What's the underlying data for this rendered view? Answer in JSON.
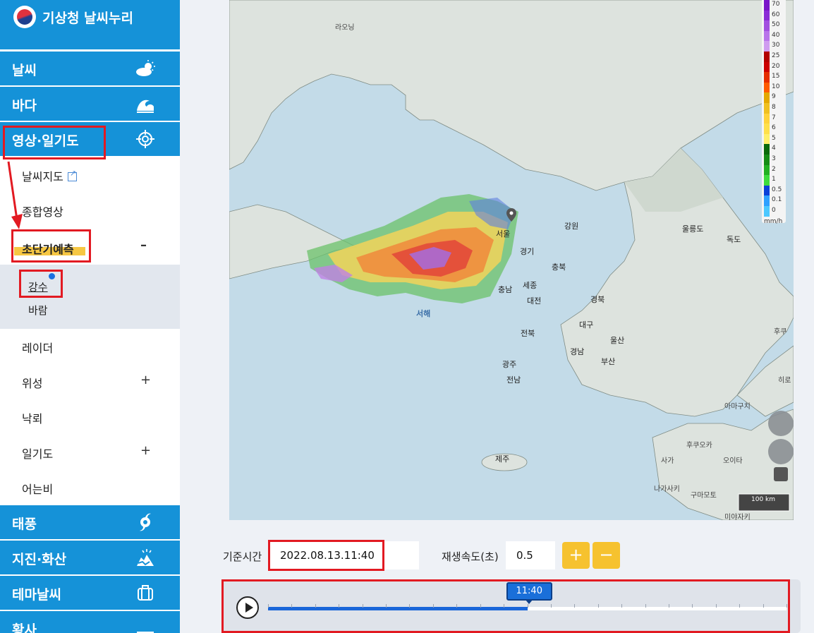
{
  "app": {
    "title": "기상청 날씨누리"
  },
  "sidebar": {
    "categories": [
      {
        "label": "날씨",
        "icon": "weather-icon"
      },
      {
        "label": "바다",
        "icon": "wave-icon"
      },
      {
        "label": "영상·일기도",
        "icon": "crosshair-icon"
      },
      {
        "label": "태풍",
        "icon": "typhoon-icon"
      },
      {
        "label": "지진·화산",
        "icon": "earthquake-icon"
      },
      {
        "label": "테마날씨",
        "icon": "suitcase-icon"
      },
      {
        "label": "황사",
        "icon": "dust-icon"
      }
    ],
    "submenu": [
      {
        "label": "날씨지도",
        "icon": "external-link-icon"
      },
      {
        "label": "종합영상"
      },
      {
        "label": "초단기예측",
        "toggle": "–"
      },
      {
        "label": "레이더"
      },
      {
        "label": "위성",
        "toggle": "+"
      },
      {
        "label": "낙뢰"
      },
      {
        "label": "일기도",
        "toggle": "+"
      },
      {
        "label": "어는비"
      }
    ],
    "subsub": [
      {
        "label": "강수",
        "selected": true
      },
      {
        "label": "바람"
      }
    ]
  },
  "map": {
    "place_labels": [
      "라오닝",
      "서해",
      "강원",
      "경기",
      "충북",
      "충남",
      "세종",
      "대전",
      "경북",
      "대구",
      "울산",
      "전북",
      "경남",
      "부산",
      "광주",
      "전남",
      "제주",
      "울릉도",
      "독도",
      "후쿠오카",
      "사가",
      "오이타",
      "나가사키",
      "구마모토",
      "미야자키",
      "아마구치",
      "히로",
      "후쿠",
      "서울"
    ],
    "scale_label": "100 km",
    "legend": {
      "unit": "mm/h",
      "ticks": [
        "70",
        "60",
        "50",
        "40",
        "30",
        "25",
        "20",
        "15",
        "10",
        "9",
        "8",
        "7",
        "6",
        "5",
        "4",
        "3",
        "2",
        "1",
        "0.5",
        "0.1",
        "0"
      ],
      "colors": [
        "#7a15c9",
        "#8a2bd6",
        "#a24fe0",
        "#b874ea",
        "#cf9cf0",
        "#b30000",
        "#cc0000",
        "#e52d00",
        "#ff5b00",
        "#e4a800",
        "#f0c020",
        "#ffd33a",
        "#ffe04a",
        "#fff06a",
        "#0a6a0a",
        "#158c15",
        "#22b022",
        "#3ddc3d",
        "#0a40d8",
        "#2ea0ff",
        "#4cc8ff"
      ]
    }
  },
  "controls": {
    "base_time_label": "기준시간",
    "base_time_value": "2022.08.13.11:40",
    "speed_label": "재생속도(초)",
    "speed_value": "0.5",
    "plus": "+",
    "minus": "−"
  },
  "timeline": {
    "current": "11:40",
    "progress": 0.5
  },
  "colors": {
    "sidebar_blue": "#1592d8",
    "accent_yellow": "#f6c22f",
    "annotation_red": "#e21a22",
    "timeline_blue": "#1a66d9"
  }
}
